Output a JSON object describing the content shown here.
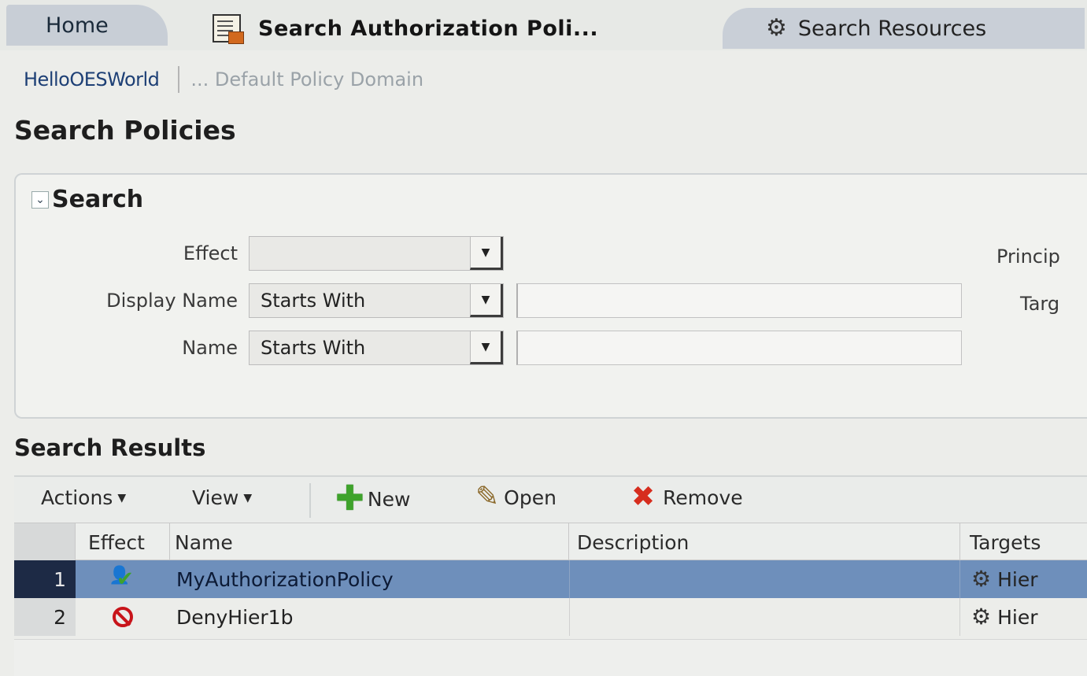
{
  "tabs": {
    "home": "Home",
    "active": "Search Authorization Poli...",
    "resources": "Search Resources"
  },
  "breadcrumb": {
    "app": "HelloOESWorld",
    "current": "... Default Policy Domain"
  },
  "page_title": "Search Policies",
  "search": {
    "title": "Search",
    "fields": {
      "effect": {
        "label": "Effect",
        "value": ""
      },
      "display_name": {
        "label": "Display Name",
        "operator": "Starts With",
        "value": ""
      },
      "name": {
        "label": "Name",
        "operator": "Starts With",
        "value": ""
      }
    },
    "right_labels": {
      "principal": "Princip",
      "target": "Targ"
    }
  },
  "results": {
    "title": "Search Results",
    "toolbar": {
      "actions": "Actions",
      "view": "View",
      "new": "New",
      "open": "Open",
      "remove": "Remove"
    },
    "columns": {
      "effect": "Effect",
      "name": "Name",
      "description": "Description",
      "targets": "Targets"
    },
    "rows": [
      {
        "num": "1",
        "effect_icon": "permit-icon",
        "name": "MyAuthorizationPolicy",
        "description": "",
        "targets": "Hier",
        "selected": true
      },
      {
        "num": "2",
        "effect_icon": "deny-icon",
        "name": "DenyHier1b",
        "description": "",
        "targets": "Hier",
        "selected": false
      }
    ]
  },
  "colors": {
    "selected_row": "#6e8fbb",
    "selected_num": "#1d2a45",
    "link": "#1d3f75",
    "add_green": "#3ea32b",
    "remove_red": "#d62d1e",
    "deny_red": "#c8141a"
  }
}
